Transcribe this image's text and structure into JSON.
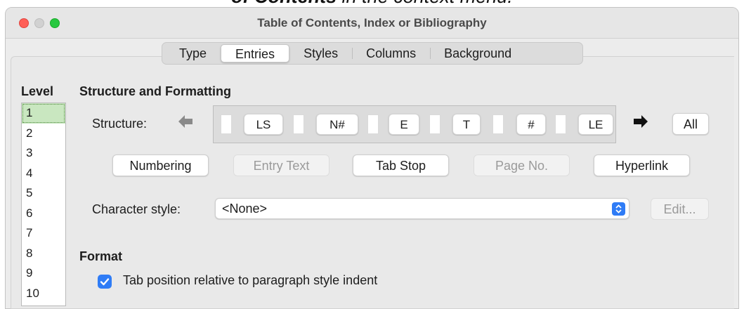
{
  "caption": {
    "bold": "of Contents",
    "rest": " in the context menu."
  },
  "window": {
    "title": "Table of Contents, Index or Bibliography"
  },
  "tabs": [
    {
      "label": "Type",
      "active": false
    },
    {
      "label": "Entries",
      "active": true
    },
    {
      "label": "Styles",
      "active": false
    },
    {
      "label": "Columns",
      "active": false
    },
    {
      "label": "Background",
      "active": false
    }
  ],
  "level": {
    "label": "Level",
    "items": [
      "1",
      "2",
      "3",
      "4",
      "5",
      "6",
      "7",
      "8",
      "9",
      "10"
    ],
    "selected": "1"
  },
  "structure_formatting": {
    "heading": "Structure and Formatting",
    "structure_label": "Structure:",
    "tokens": [
      "LS",
      "N#",
      "E",
      "T",
      "#",
      "LE"
    ],
    "all_button": "All",
    "insert_buttons": [
      {
        "label": "Numbering",
        "enabled": true
      },
      {
        "label": "Entry Text",
        "enabled": false
      },
      {
        "label": "Tab Stop",
        "enabled": true
      },
      {
        "label": "Page No.",
        "enabled": false
      },
      {
        "label": "Hyperlink",
        "enabled": true
      }
    ],
    "character_style_label": "Character style:",
    "character_style_value": "<None>",
    "edit_button": "Edit..."
  },
  "format": {
    "heading": "Format",
    "tab_position_label": "Tab position relative to paragraph style indent",
    "tab_position_checked": true
  },
  "colors": {
    "accent": "#2f7cf6",
    "selection": "#c9e7c0"
  },
  "icons": {
    "left_arrow": "arrow-left-icon",
    "right_arrow": "arrow-right-icon",
    "stepper": "up-down-stepper-icon",
    "check": "checkmark-icon"
  }
}
